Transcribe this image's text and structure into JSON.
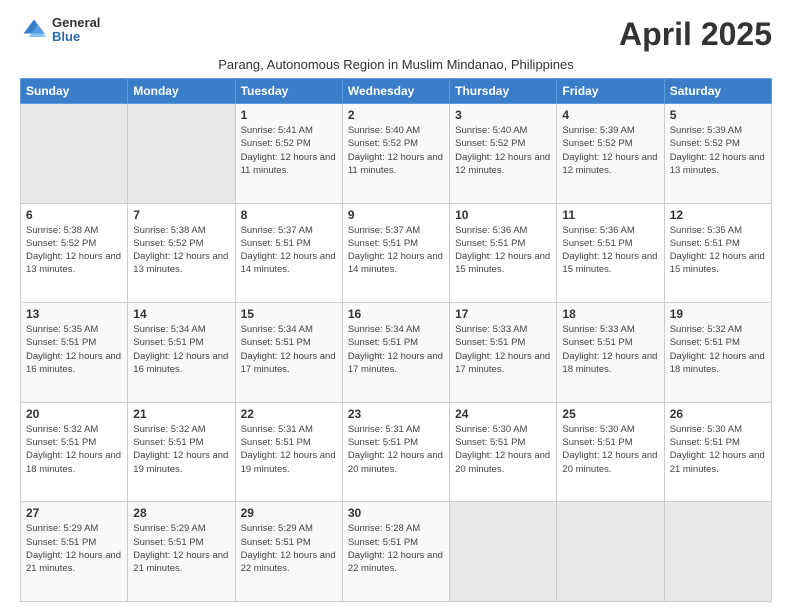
{
  "logo": {
    "general": "General",
    "blue": "Blue"
  },
  "title": "April 2025",
  "subtitle": "Parang, Autonomous Region in Muslim Mindanao, Philippines",
  "headers": [
    "Sunday",
    "Monday",
    "Tuesday",
    "Wednesday",
    "Thursday",
    "Friday",
    "Saturday"
  ],
  "weeks": [
    [
      {
        "day": "",
        "info": ""
      },
      {
        "day": "",
        "info": ""
      },
      {
        "day": "1",
        "info": "Sunrise: 5:41 AM\nSunset: 5:52 PM\nDaylight: 12 hours and 11 minutes."
      },
      {
        "day": "2",
        "info": "Sunrise: 5:40 AM\nSunset: 5:52 PM\nDaylight: 12 hours and 11 minutes."
      },
      {
        "day": "3",
        "info": "Sunrise: 5:40 AM\nSunset: 5:52 PM\nDaylight: 12 hours and 12 minutes."
      },
      {
        "day": "4",
        "info": "Sunrise: 5:39 AM\nSunset: 5:52 PM\nDaylight: 12 hours and 12 minutes."
      },
      {
        "day": "5",
        "info": "Sunrise: 5:39 AM\nSunset: 5:52 PM\nDaylight: 12 hours and 13 minutes."
      }
    ],
    [
      {
        "day": "6",
        "info": "Sunrise: 5:38 AM\nSunset: 5:52 PM\nDaylight: 12 hours and 13 minutes."
      },
      {
        "day": "7",
        "info": "Sunrise: 5:38 AM\nSunset: 5:52 PM\nDaylight: 12 hours and 13 minutes."
      },
      {
        "day": "8",
        "info": "Sunrise: 5:37 AM\nSunset: 5:51 PM\nDaylight: 12 hours and 14 minutes."
      },
      {
        "day": "9",
        "info": "Sunrise: 5:37 AM\nSunset: 5:51 PM\nDaylight: 12 hours and 14 minutes."
      },
      {
        "day": "10",
        "info": "Sunrise: 5:36 AM\nSunset: 5:51 PM\nDaylight: 12 hours and 15 minutes."
      },
      {
        "day": "11",
        "info": "Sunrise: 5:36 AM\nSunset: 5:51 PM\nDaylight: 12 hours and 15 minutes."
      },
      {
        "day": "12",
        "info": "Sunrise: 5:35 AM\nSunset: 5:51 PM\nDaylight: 12 hours and 15 minutes."
      }
    ],
    [
      {
        "day": "13",
        "info": "Sunrise: 5:35 AM\nSunset: 5:51 PM\nDaylight: 12 hours and 16 minutes."
      },
      {
        "day": "14",
        "info": "Sunrise: 5:34 AM\nSunset: 5:51 PM\nDaylight: 12 hours and 16 minutes."
      },
      {
        "day": "15",
        "info": "Sunrise: 5:34 AM\nSunset: 5:51 PM\nDaylight: 12 hours and 17 minutes."
      },
      {
        "day": "16",
        "info": "Sunrise: 5:34 AM\nSunset: 5:51 PM\nDaylight: 12 hours and 17 minutes."
      },
      {
        "day": "17",
        "info": "Sunrise: 5:33 AM\nSunset: 5:51 PM\nDaylight: 12 hours and 17 minutes."
      },
      {
        "day": "18",
        "info": "Sunrise: 5:33 AM\nSunset: 5:51 PM\nDaylight: 12 hours and 18 minutes."
      },
      {
        "day": "19",
        "info": "Sunrise: 5:32 AM\nSunset: 5:51 PM\nDaylight: 12 hours and 18 minutes."
      }
    ],
    [
      {
        "day": "20",
        "info": "Sunrise: 5:32 AM\nSunset: 5:51 PM\nDaylight: 12 hours and 18 minutes."
      },
      {
        "day": "21",
        "info": "Sunrise: 5:32 AM\nSunset: 5:51 PM\nDaylight: 12 hours and 19 minutes."
      },
      {
        "day": "22",
        "info": "Sunrise: 5:31 AM\nSunset: 5:51 PM\nDaylight: 12 hours and 19 minutes."
      },
      {
        "day": "23",
        "info": "Sunrise: 5:31 AM\nSunset: 5:51 PM\nDaylight: 12 hours and 20 minutes."
      },
      {
        "day": "24",
        "info": "Sunrise: 5:30 AM\nSunset: 5:51 PM\nDaylight: 12 hours and 20 minutes."
      },
      {
        "day": "25",
        "info": "Sunrise: 5:30 AM\nSunset: 5:51 PM\nDaylight: 12 hours and 20 minutes."
      },
      {
        "day": "26",
        "info": "Sunrise: 5:30 AM\nSunset: 5:51 PM\nDaylight: 12 hours and 21 minutes."
      }
    ],
    [
      {
        "day": "27",
        "info": "Sunrise: 5:29 AM\nSunset: 5:51 PM\nDaylight: 12 hours and 21 minutes."
      },
      {
        "day": "28",
        "info": "Sunrise: 5:29 AM\nSunset: 5:51 PM\nDaylight: 12 hours and 21 minutes."
      },
      {
        "day": "29",
        "info": "Sunrise: 5:29 AM\nSunset: 5:51 PM\nDaylight: 12 hours and 22 minutes."
      },
      {
        "day": "30",
        "info": "Sunrise: 5:28 AM\nSunset: 5:51 PM\nDaylight: 12 hours and 22 minutes."
      },
      {
        "day": "",
        "info": ""
      },
      {
        "day": "",
        "info": ""
      },
      {
        "day": "",
        "info": ""
      }
    ]
  ]
}
